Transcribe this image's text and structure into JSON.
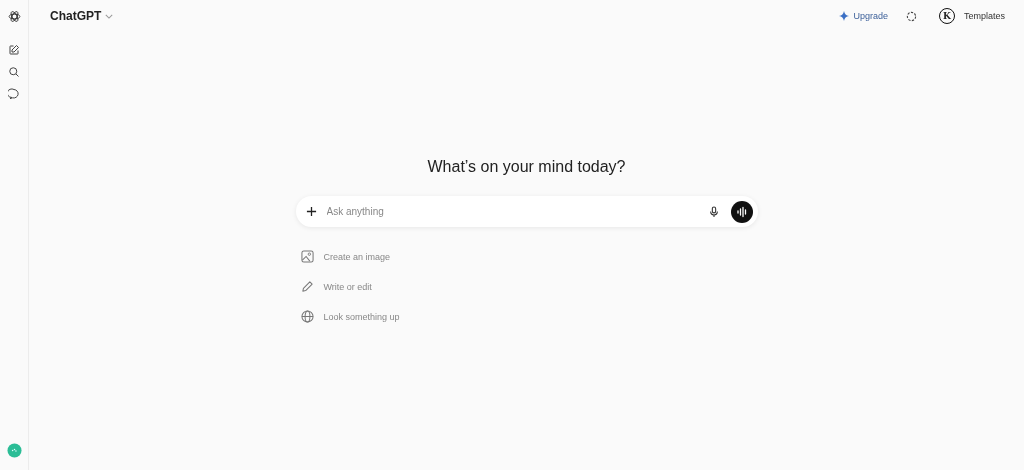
{
  "header": {
    "model": "ChatGPT",
    "upgrade": "Upgrade",
    "avatar": "K",
    "workspace": "Templates"
  },
  "heading": "What’s on your mind today?",
  "composer": {
    "placeholder": "Ask anything"
  },
  "suggestions": [
    {
      "kind": "image",
      "label": "Create an image"
    },
    {
      "kind": "write",
      "label": "Write or edit"
    },
    {
      "kind": "search",
      "label": "Look something up"
    }
  ]
}
